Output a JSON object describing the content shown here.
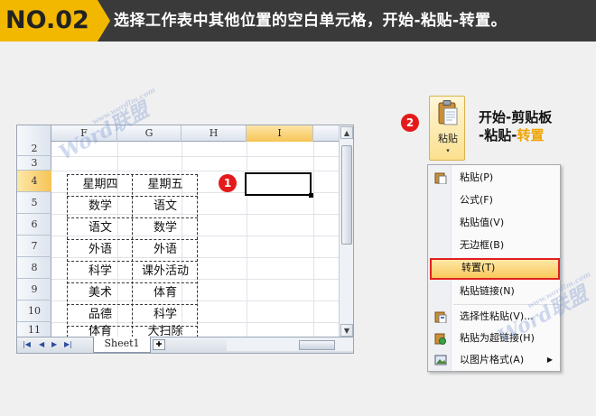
{
  "banner": {
    "number": "NO.02",
    "title": "选择工作表中其他位置的空白单元格，开始-粘贴-转置。"
  },
  "sheet": {
    "columns": [
      "F",
      "G",
      "H",
      "I"
    ],
    "rows": [
      "2",
      "3",
      "4",
      "5",
      "6",
      "7",
      "8",
      "9",
      "10",
      "11"
    ],
    "table": [
      [
        "星期四",
        "星期五"
      ],
      [
        "数学",
        "语文"
      ],
      [
        "语文",
        "数学"
      ],
      [
        "外语",
        "外语"
      ],
      [
        "科学",
        "课外活动"
      ],
      [
        "美术",
        "体育"
      ],
      [
        "品德",
        "科学"
      ],
      [
        "体育",
        "大扫除"
      ]
    ],
    "tab_label": "Sheet1"
  },
  "badges": {
    "one": "1",
    "two": "2"
  },
  "paste_button": {
    "label": "粘贴",
    "arrow": "▾"
  },
  "caption": {
    "line1": "开始-剪贴板",
    "line2_prefix": "-粘贴-",
    "line2_highlight": "转置"
  },
  "menu": {
    "items": [
      {
        "label": "粘贴(P)",
        "icon": "paste-icon"
      },
      {
        "label": "公式(F)",
        "icon": ""
      },
      {
        "label": "粘贴值(V)",
        "icon": ""
      },
      {
        "label": "无边框(B)",
        "icon": ""
      },
      {
        "label": "转置(T)",
        "icon": "",
        "selected": true
      },
      {
        "label": "粘贴链接(N)",
        "icon": ""
      },
      {
        "label": "选择性粘贴(V)...",
        "icon": "paste-special-icon"
      },
      {
        "label": "粘贴为超链接(H)",
        "icon": "paste-hyperlink-icon"
      },
      {
        "label": "以图片格式(A)",
        "icon": "picture-icon",
        "submenu": true
      }
    ]
  },
  "watermark": "Word联盟",
  "watermark_url": "www.wordlm.com",
  "colors": {
    "accent": "#f2b800",
    "banner": "#3a3a3a",
    "badge": "#e41a1a",
    "highlight": "#f0a400"
  }
}
